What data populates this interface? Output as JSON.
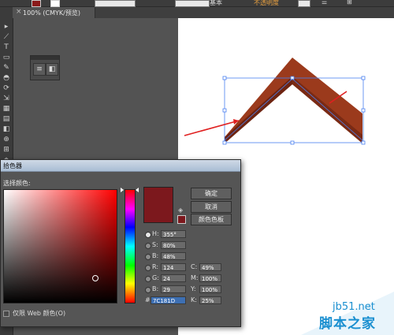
{
  "app": {
    "top_bar": {
      "stroke_label": "基本",
      "style_label": "不透明度"
    },
    "document_tab": {
      "close": "×",
      "title": "100% (CMYK/预览)"
    },
    "tools": [
      "▸",
      "⟋",
      "T",
      "▭",
      "✎",
      "◓",
      "⟳",
      "⇲",
      "▦",
      "▤",
      "◧",
      "⊕",
      "⊞",
      "⌖"
    ]
  },
  "mini_panel": {
    "button1_icon": "list-icon",
    "button2_icon": "gradient-icon"
  },
  "color_picker": {
    "title": "拾色器",
    "prompt": "选择颜色:",
    "colors": {
      "selected": "#7C181D",
      "hue_pure": "#FF0000"
    },
    "buttons": {
      "ok": "确定",
      "cancel": "取消",
      "swatches": "颜色色板"
    },
    "fields": {
      "h": {
        "label": "H:",
        "value": "355°"
      },
      "s": {
        "label": "S:",
        "value": "80%"
      },
      "b": {
        "label": "B:",
        "value": "48%"
      },
      "r": {
        "label": "R:",
        "value": "124"
      },
      "g": {
        "label": "G:",
        "value": "24"
      },
      "bl": {
        "label": "B:",
        "value": "29"
      },
      "hex": {
        "label": "#",
        "value": "7C181D"
      },
      "c": {
        "label": "C:",
        "value": "49%"
      },
      "m": {
        "label": "M:",
        "value": "100%"
      },
      "y": {
        "label": "Y:",
        "value": "100%"
      },
      "k": {
        "label": "K:",
        "value": "25%"
      }
    },
    "web_only": "仅限 Web 颜色(O)"
  },
  "artwork": {
    "shape_color": "#9b3a1c",
    "annotation_color": "#e02020",
    "selection_color": "#4a7ff0"
  },
  "watermark": {
    "url": "jb51.net",
    "name": "脚本之家"
  }
}
